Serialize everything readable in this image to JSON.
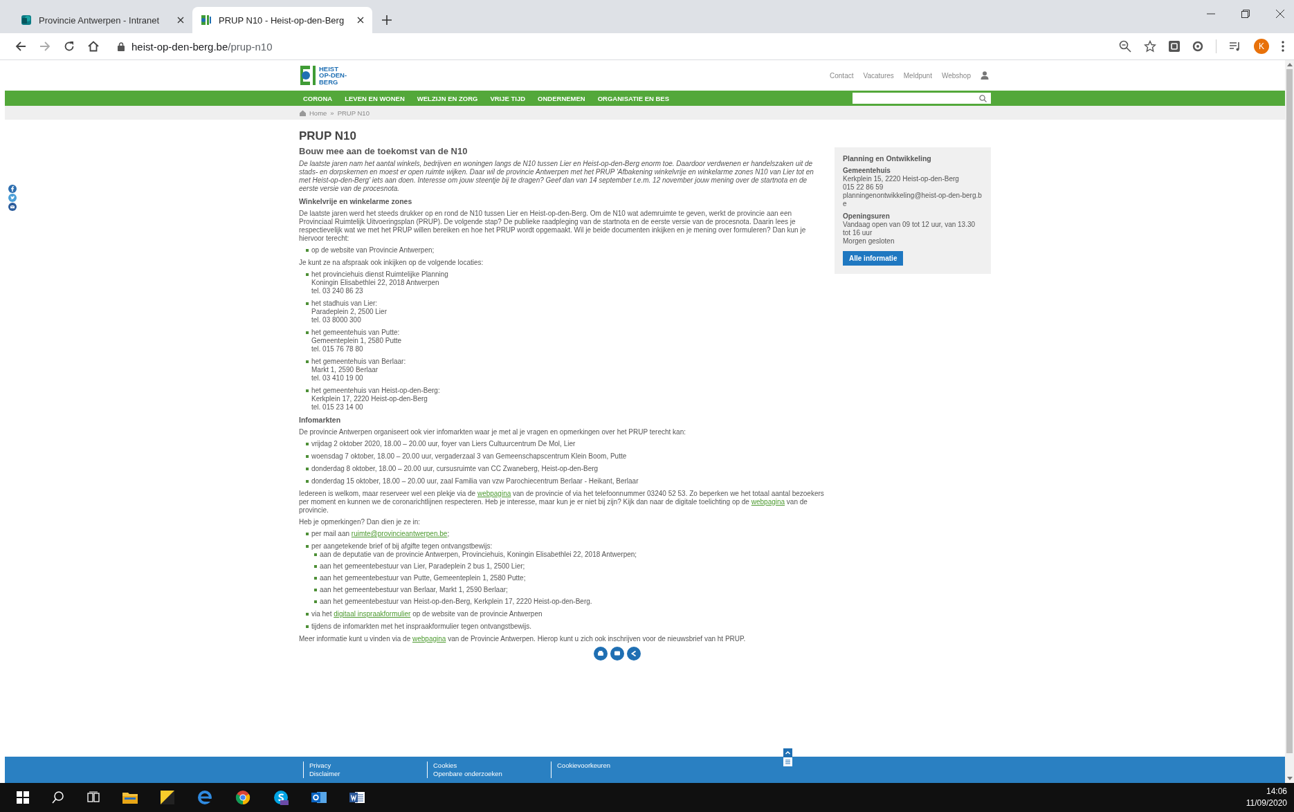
{
  "browser": {
    "tabs": [
      {
        "title": "Provincie Antwerpen - Intranet",
        "selected": false
      },
      {
        "title": "PRUP N10 - Heist-op-den-Berg",
        "selected": true
      }
    ],
    "url": {
      "host": "heist-op-den-berg.be",
      "path": "/prup-n10"
    },
    "avatar_letter": "K"
  },
  "site": {
    "logo_lines": [
      "HEIST",
      "OP-DEN-",
      "BERG"
    ],
    "top_links": [
      "Contact",
      "Vacatures",
      "Meldpunt",
      "Webshop"
    ],
    "nav": [
      "CORONA",
      "LEVEN EN WONEN",
      "WELZIJN EN ZORG",
      "VRIJE TIJD",
      "ONDERNEMEN",
      "ORGANISATIE EN BES"
    ],
    "breadcrumb": {
      "items": [
        "Home",
        "PRUP N10"
      ],
      "separator": "»"
    }
  },
  "article": {
    "title": "PRUP N10",
    "subtitle": "Bouw mee aan de toekomst van de N10",
    "blocks": [
      {
        "kind": "intro",
        "text": "De laatste jaren nam het aantal winkels, bedrijven en woningen langs de N10 tussen Lier en Heist-op-den-Berg enorm toe. Daardoor verdwenen er handelszaken uit de stads- en dorpskernen en moest er open ruimte wijken. Daar wil de provincie Antwerpen met het PRUP 'Afbakening winkelvrije en winkelarme zones N10 van Lier tot en met Heist-op-den-Berg' iets aan doen. Interesse om jouw steentje bij te dragen? Geef dan van 14 september t.e.m. 12 november jouw mening over de startnota en de eerste versie van de procesnota."
      },
      {
        "kind": "heading",
        "text": "Winkelvrije en winkelarme zones"
      },
      {
        "kind": "paragraph",
        "text": "De laatste jaren werd het steeds drukker op en rond de N10 tussen Lier en Heist-op-den-Berg. Om de N10 wat ademruimte te geven, werkt de provincie aan een Provinciaal Ruimtelijk Uitvoeringsplan (PRUP). De volgende stap? De publieke raadpleging van de startnota en de eerste versie van de procesnota. Daarin lees je respectievelijk wat we met het PRUP willen bereiken en hoe het PRUP wordt opgemaakt. Wil je beide documenten inkijken en je mening over formuleren? Dan kun je hiervoor terecht:"
      },
      {
        "kind": "list",
        "items": [
          {
            "text": "op de website van Provincie Antwerpen;"
          }
        ]
      },
      {
        "kind": "paragraph",
        "text": "Je kunt ze na afspraak ook inkijken op de volgende locaties:"
      },
      {
        "kind": "list",
        "items": [
          {
            "lines": [
              "het provinciehuis dienst Ruimtelijke Planning",
              "Koningin Elisabethlei 22, 2018 Antwerpen",
              "tel. 03 240 86 23"
            ]
          },
          {
            "lines": [
              "het stadhuis van Lier:",
              "Paradeplein 2, 2500 Lier",
              "tel. 03 8000 300"
            ]
          },
          {
            "lines": [
              "het gemeentehuis van Putte:",
              "Gemeenteplein 1, 2580 Putte",
              "tel. 015 76 78 80"
            ]
          },
          {
            "lines": [
              "het gemeentehuis van Berlaar:",
              "Markt 1, 2590 Berlaar",
              "tel. 03 410 19 00"
            ]
          },
          {
            "lines": [
              "het gemeentehuis van Heist-op-den-Berg:",
              "Kerkplein 17, 2220 Heist-op-den-Berg",
              "tel. 015 23 14 00"
            ]
          }
        ]
      },
      {
        "kind": "heading",
        "text": "Infomarkten"
      },
      {
        "kind": "paragraph",
        "text": "De provincie Antwerpen organiseert ook vier infomarkten waar je met al je vragen en opmerkingen over het PRUP terecht kan:"
      },
      {
        "kind": "list",
        "items": [
          {
            "text": "vrijdag 2 oktober 2020, 18.00 – 20.00 uur, foyer van Liers Cultuurcentrum De Mol, Lier"
          },
          {
            "text": "woensdag 7 oktober, 18.00 – 20.00 uur, vergaderzaal 3 van Gemeenschapscentrum Klein Boom, Putte"
          },
          {
            "text": "donderdag 8 oktober, 18.00 – 20.00 uur, cursusruimte van CC Zwaneberg, Heist-op-den-Berg"
          },
          {
            "text": "donderdag 15 oktober, 18.00 – 20.00 uur, zaal Familia van vzw Parochiecentrum Berlaar - Heikant, Berlaar"
          }
        ]
      },
      {
        "kind": "paragraph",
        "parts": [
          {
            "text": "Iedereen is welkom, maar reserveer wel een plekje via de "
          },
          {
            "text": "webpagina",
            "kind": "link"
          },
          {
            "text": " van de provincie of via het telefoonnummer 03240 52 53. Zo beperken we het totaal aantal bezoekers per moment en kunnen we de coronarichtlijnen respecteren. Heb je interesse, maar kun je er niet bij zijn? Kijk dan naar de digitale toelichting op de "
          },
          {
            "text": "webpagina",
            "kind": "link"
          },
          {
            "text": " van de provincie."
          }
        ]
      },
      {
        "kind": "paragraph",
        "text": "Heb je opmerkingen? Dan dien je ze in:"
      },
      {
        "kind": "list",
        "items": [
          {
            "parts": [
              {
                "text": "per mail aan "
              },
              {
                "text": "ruimte@provincieantwerpen.be",
                "kind": "link"
              },
              {
                "text": ";"
              }
            ]
          },
          {
            "text": "per aangetekende brief of bij afgifte tegen ontvangstbewijs:",
            "children": [
              {
                "text": "aan de deputatie van de provincie Antwerpen, Provinciehuis, Koningin Elisabethlei 22, 2018 Antwerpen;"
              },
              {
                "text": "aan het gemeentebestuur van Lier, Paradeplein 2 bus 1, 2500 Lier;"
              },
              {
                "text": "aan het gemeentebestuur van Putte, Gemeenteplein 1, 2580 Putte;"
              },
              {
                "text": "aan het gemeentebestuur van Berlaar, Markt 1, 2590 Berlaar;"
              },
              {
                "text": "aan het gemeentebestuur van Heist-op-den-Berg, Kerkplein 17, 2220 Heist-op-den-Berg."
              }
            ]
          },
          {
            "parts": [
              {
                "text": "via het "
              },
              {
                "text": "digitaal inspraakformulier",
                "kind": "link"
              },
              {
                "text": " op de website van de provincie Antwerpen"
              }
            ]
          },
          {
            "text": "tijdens de infomarkten met het inspraakformulier tegen ontvangstbewijs."
          }
        ]
      },
      {
        "kind": "paragraph",
        "parts": [
          {
            "text": "Meer informatie kunt u vinden via de "
          },
          {
            "text": "webpagina",
            "kind": "link"
          },
          {
            "text": " van de Provincie Antwerpen. Hierop kunt u zich ook inschrijven voor de nieuwsbrief van ht PRUP."
          }
        ]
      }
    ]
  },
  "sidebar": {
    "title": "Planning en Ontwikkeling",
    "place": "Gemeentehuis",
    "address": "Kerkplein 15, 2220 Heist-op-den-Berg",
    "phone": "015 22 86 59",
    "email": "planningenontwikkeling@heist-op-den-berg.be",
    "hours_label": "Openingsuren",
    "hours": [
      "Vandaag open van 09 tot 12 uur, van 13.30 tot 16 uur",
      "Morgen gesloten"
    ],
    "button": "Alle informatie"
  },
  "footer": {
    "columns": [
      [
        "Privacy",
        "Disclaimer"
      ],
      [
        "Cookies",
        "Openbare onderzoeken"
      ],
      [
        "Cookievoorkeuren"
      ]
    ]
  },
  "taskbar": {
    "time": "14:06",
    "date": "11/09/2020"
  }
}
